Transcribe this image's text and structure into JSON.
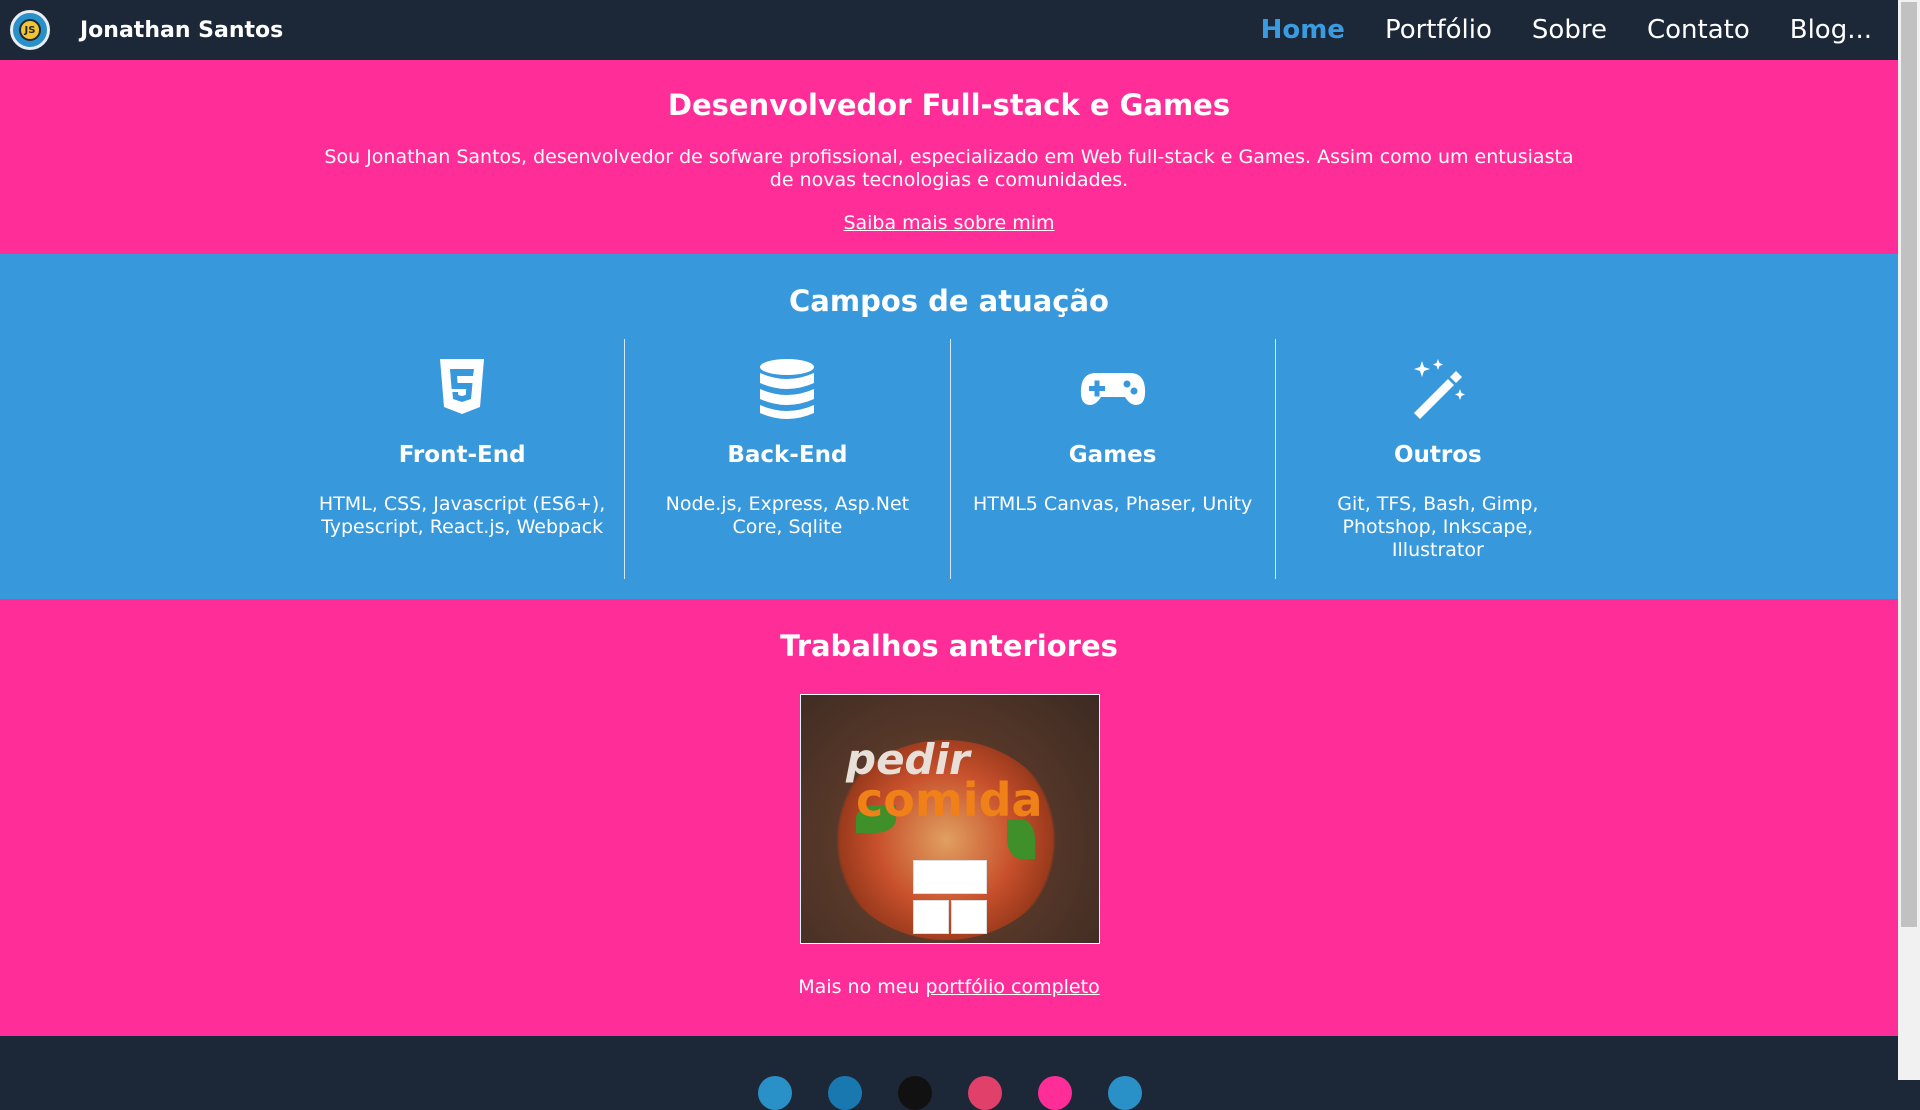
{
  "navbar": {
    "logo_text": "JS",
    "brand": "Jonathan Santos",
    "items": [
      {
        "label": "Home",
        "active": true
      },
      {
        "label": "Portfólio"
      },
      {
        "label": "Sobre"
      },
      {
        "label": "Contato"
      },
      {
        "label": "Blog..."
      }
    ]
  },
  "hero": {
    "title": "Desenvolvedor Full-stack e Games",
    "description": "Sou Jonathan Santos, desenvolvedor de sofware profissional, especializado em Web full-stack e Games. Assim como um entusiasta de novas tecnologias e comunidades.",
    "link": "Saiba mais sobre mim"
  },
  "fields": {
    "title": "Campos de atuação",
    "items": [
      {
        "icon": "html5-icon",
        "title": "Front-End",
        "text": "HTML, CSS, Javascript (ES6+), Typescript, React.js, Webpack"
      },
      {
        "icon": "database-icon",
        "title": "Back-End",
        "text": "Node.js, Express, Asp.Net Core, Sqlite"
      },
      {
        "icon": "gamepad-icon",
        "title": "Games",
        "text": "HTML5 Canvas, Phaser, Unity"
      },
      {
        "icon": "magic-wand-icon",
        "title": "Outros",
        "text": "Git, TFS, Bash, Gimp, Photshop, Inkscape, Illustrator"
      }
    ]
  },
  "works": {
    "title": "Trabalhos anteriores",
    "project_logo_top": "pedir",
    "project_logo_bottom": "comida",
    "more_prefix": "Mais no meu ",
    "more_link": "portfólio completo"
  },
  "colors": {
    "nav_bg": "#1c2838",
    "pink": "#ff2d98",
    "blue": "#3898dc",
    "active": "#3a9be0"
  },
  "footer": {
    "social_colors": [
      "#2a90c8",
      "#1a78b0",
      "#111111",
      "#e0406a",
      "#ff2d98",
      "#2a90c8"
    ]
  }
}
